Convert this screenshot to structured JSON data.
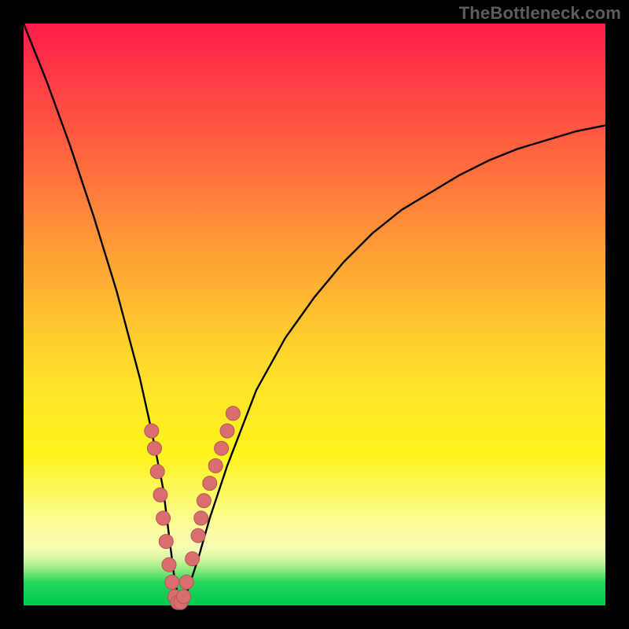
{
  "watermark": "TheBottleneck.com",
  "colors": {
    "curve_stroke": "#000000",
    "marker_fill": "#d96e6e",
    "marker_stroke": "#b85555",
    "frame_bg": "#000000"
  },
  "chart_data": {
    "type": "line",
    "title": "",
    "xlabel": "",
    "ylabel": "",
    "xlim": [
      0,
      100
    ],
    "ylim": [
      0,
      100
    ],
    "x": [
      0,
      4,
      8,
      12,
      16,
      20,
      22,
      24,
      25,
      26,
      27,
      28,
      30,
      32,
      35,
      40,
      45,
      50,
      55,
      60,
      65,
      70,
      75,
      80,
      85,
      90,
      95,
      100
    ],
    "y": [
      100,
      90,
      79,
      67,
      54,
      39,
      30,
      20,
      12,
      4,
      0,
      2,
      8,
      15,
      24,
      37,
      46,
      53,
      59,
      64,
      68,
      71,
      74,
      76.5,
      78.5,
      80,
      81.5,
      82.5
    ],
    "series": [
      {
        "name": "markers",
        "x": [
          22,
          22.5,
          23,
          23.5,
          24,
          24.5,
          25,
          25.5,
          26,
          26.5,
          27,
          27.5,
          28,
          29,
          30,
          30.5,
          31,
          32,
          33,
          34,
          35,
          36
        ],
        "y": [
          30,
          27,
          23,
          19,
          15,
          11,
          7,
          4,
          1.5,
          0.5,
          0.5,
          1.5,
          4,
          8,
          12,
          15,
          18,
          21,
          24,
          27,
          30,
          33
        ]
      }
    ]
  }
}
